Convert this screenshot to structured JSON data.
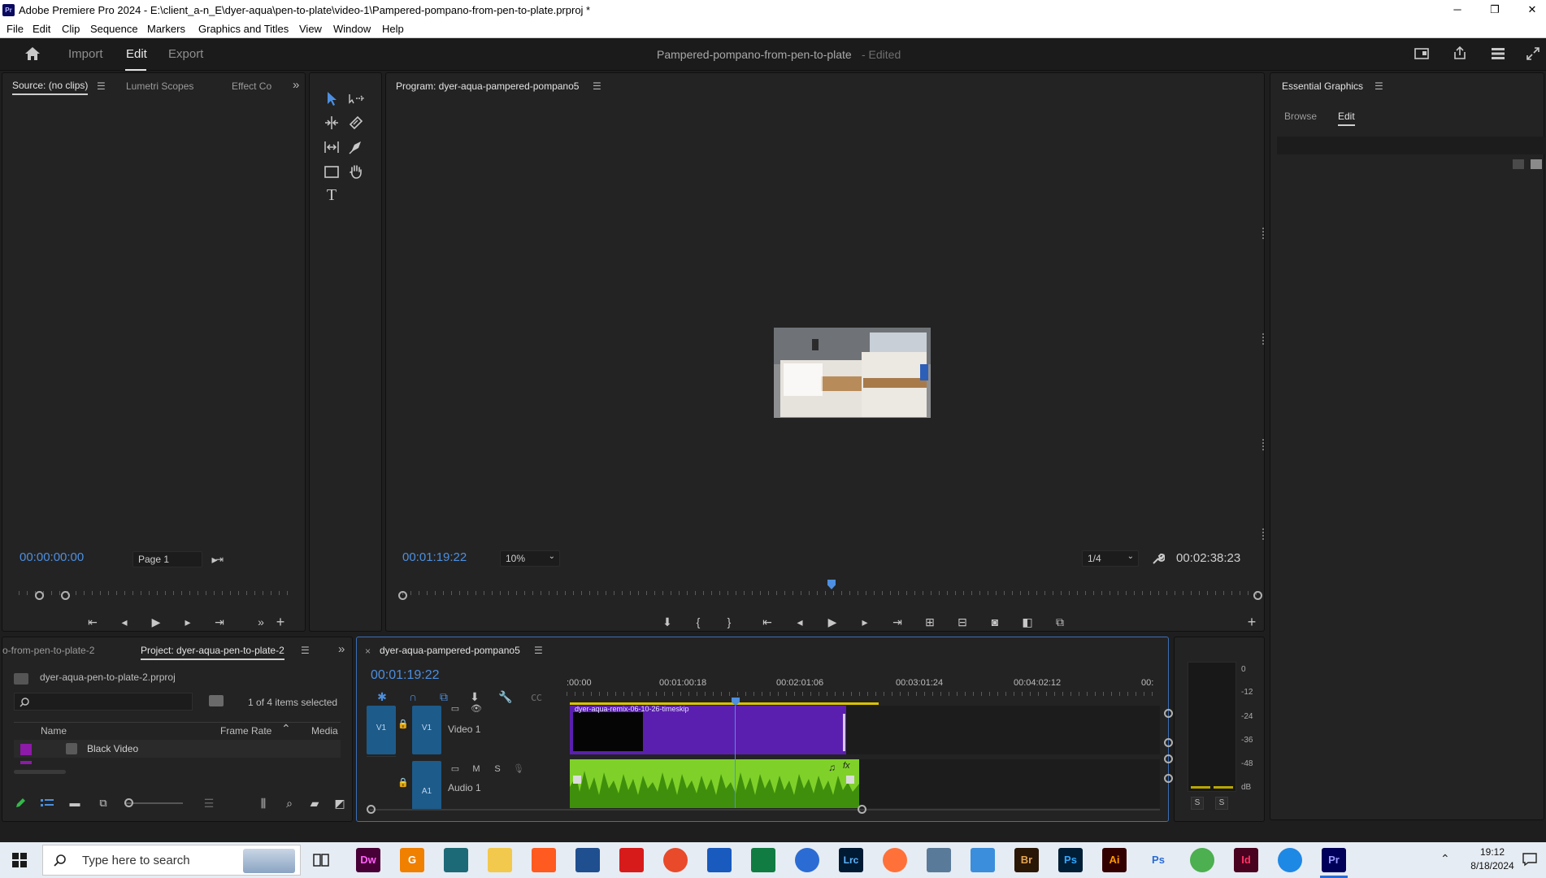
{
  "titlebar": {
    "app_icon": "Pr",
    "title": "Adobe Premiere Pro 2024 - E:\\client_a-n_E\\dyer-aqua\\pen-to-plate\\video-1\\Pampered-pompano-from-pen-to-plate.prproj *",
    "minimize": "─",
    "restore": "❐",
    "close": "✕"
  },
  "menubar": {
    "items": [
      "File",
      "Edit",
      "Clip",
      "Sequence",
      "Markers",
      "Graphics and Titles",
      "View",
      "Window",
      "Help"
    ]
  },
  "header": {
    "home_icon": "⌂",
    "tabs": [
      "Import",
      "Edit",
      "Export"
    ],
    "active_tab": "Edit",
    "project_title": "Pampered-pompano-from-pen-to-plate",
    "edited_status": "- Edited"
  },
  "source_panel": {
    "tabs": [
      "Source: (no clips)",
      "Lumetri Scopes",
      "Effect Co"
    ],
    "overflow": "»",
    "timecode": "00:00:00:00",
    "page_dropdown": "Page 1"
  },
  "tools": {
    "icons": [
      "selection-tool-icon",
      "track-select-tool-icon",
      "ripple-edit-tool-icon",
      "razor-tool-icon",
      "slip-tool-icon",
      "pen-tool-icon",
      "rectangle-tool-icon",
      "hand-tool-icon",
      "type-tool-icon"
    ],
    "type_glyph": "T"
  },
  "program_panel": {
    "title": "Program: dyer-aqua-pampered-pompano5",
    "timecode": "00:01:19:22",
    "zoom": "10%",
    "resolution": "1/4",
    "duration": "00:02:38:23",
    "playhead_fraction": 0.5
  },
  "essential_graphics": {
    "title": "Essential Graphics",
    "tabs": [
      "Browse",
      "Edit"
    ],
    "active_tab": "Edit"
  },
  "project_panel": {
    "tabs": [
      "o-from-pen-to-plate-2",
      "Project: dyer-aqua-pen-to-plate-2"
    ],
    "project_file": "dyer-aqua-pen-to-plate-2.prproj",
    "selection_status": "1 of 4 items selected",
    "columns": [
      "Name",
      "Frame Rate",
      "Media"
    ],
    "rows": [
      "Black Video"
    ]
  },
  "timeline": {
    "close": "×",
    "sequence_name": "dyer-aqua-pampered-pompano5",
    "timecode": "00:01:19:22",
    "ruler_labels": [
      ":00:00",
      "00:01:00:18",
      "00:02:01:06",
      "00:03:01:24",
      "00:04:02:12",
      "00:"
    ],
    "video_track": {
      "source": "V1",
      "target": "V1",
      "name": "Video 1"
    },
    "audio_track": {
      "target": "A1",
      "name": "Audio 1",
      "buttons": [
        "M",
        "S"
      ]
    },
    "clip_label": "dyer-aqua-remix-06-10-26-timeskip"
  },
  "audio_meter": {
    "scale": [
      "0",
      "-12",
      "-24",
      "-36",
      "-48",
      "dB"
    ],
    "solo_buttons": [
      "S",
      "S"
    ]
  },
  "taskbar": {
    "search_placeholder": "Type here to search",
    "time": "19:12",
    "date": "8/18/2024",
    "apps": [
      {
        "name": "Dw",
        "color": "#35fa00"
      },
      {
        "name": "G",
        "color": "#f4a340"
      },
      {
        "name": "Br",
        "color": "#2a1706"
      },
      {
        "name": "Ps",
        "color": "#001e36"
      },
      {
        "name": "Ai",
        "color": "#330000"
      },
      {
        "name": "Ps",
        "color": "#ffffff"
      },
      {
        "name": "Id",
        "color": "#49021f"
      },
      {
        "name": "Pr",
        "color": "#00005b"
      },
      {
        "name": "Lrc",
        "color": "#001a33"
      }
    ]
  },
  "colors": {
    "accent_blue": "#4d8fe0",
    "video_clip": "#5b1fb0",
    "audio_clip": "#7fd12a",
    "track_blue": "#1d5b8a"
  }
}
